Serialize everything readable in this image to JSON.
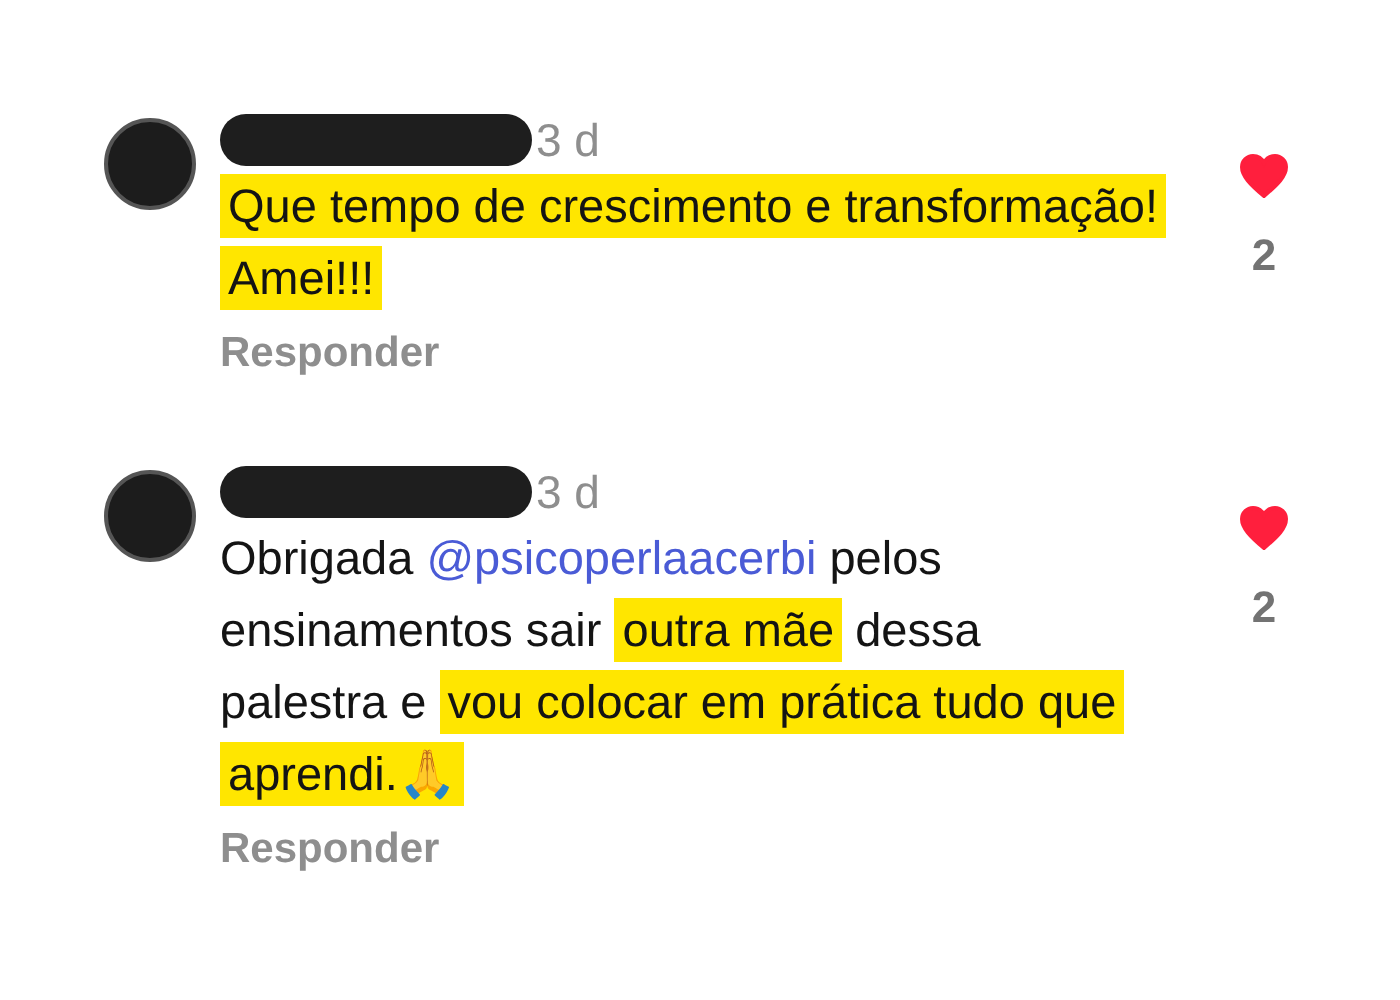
{
  "comments": [
    {
      "time": "3 d",
      "segments": [
        {
          "kind": "highlight",
          "text": "Que tempo de crescimento e transformação! Amei!!!"
        }
      ],
      "liked": true,
      "like_count": "2",
      "reply": "Responder"
    },
    {
      "time": "3 d",
      "segments": [
        {
          "kind": "plain",
          "text": "Obrigada "
        },
        {
          "kind": "mention",
          "text": "@psicoperlaacerbi"
        },
        {
          "kind": "plain",
          "text": " pelos ensinamentos sair "
        },
        {
          "kind": "highlight",
          "text": "outra mãe"
        },
        {
          "kind": "plain",
          "text": " dessa palestra e "
        },
        {
          "kind": "highlight",
          "text": "vou colocar em prática tudo que aprendi.🙏"
        }
      ],
      "liked": true,
      "like_count": "2",
      "reply": "Responder"
    }
  ]
}
